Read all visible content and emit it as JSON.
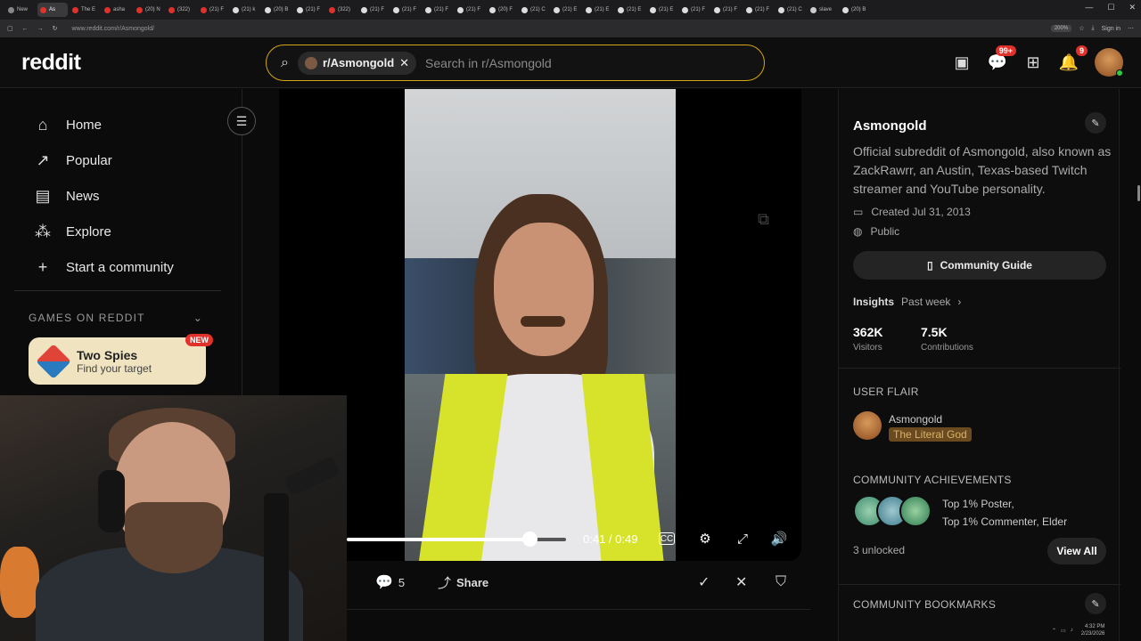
{
  "browser": {
    "tabs": [
      "New",
      "As",
      "The E",
      "asha",
      "(20) N",
      "(322)",
      "(21) F",
      "(21) k",
      "(20) B",
      "(21) F",
      "(322)",
      "(21) F",
      "(21) F",
      "(21) F",
      "(21) F",
      "(20) F",
      "(21) C",
      "(21) E",
      "(21) E",
      "(21) E",
      "(21) E",
      "(21) F",
      "(21) F",
      "(21) F",
      "(21) C",
      "slave",
      "(20) B"
    ],
    "active_tab": 1,
    "url": "www.reddit.com/r/Asmongold/",
    "zoom": "200%",
    "sign_in": "Sign in"
  },
  "header": {
    "logo": "reddit",
    "search_chip": "r/Asmongold",
    "search_placeholder": "Search in r/Asmongold",
    "chat_badge": "99+",
    "notif_badge": "9"
  },
  "sidebar": {
    "items": [
      {
        "label": "Home",
        "icon": "home-icon",
        "glyph": "⌂"
      },
      {
        "label": "Popular",
        "icon": "popular-icon",
        "glyph": "↗"
      },
      {
        "label": "News",
        "icon": "news-icon",
        "glyph": "▤"
      },
      {
        "label": "Explore",
        "icon": "explore-icon",
        "glyph": "⁂"
      },
      {
        "label": "Start a community",
        "icon": "plus-icon",
        "glyph": "+"
      }
    ],
    "games_header": "GAMES ON REDDIT",
    "game": {
      "title": "Two Spies",
      "subtitle": "Find your target",
      "badge": "NEW"
    }
  },
  "video": {
    "time": "0:41 / 0:49",
    "progress": 0.837,
    "cc_label": "CC"
  },
  "post_actions": {
    "comments": "5",
    "share": "Share"
  },
  "community": {
    "name": "Asmongold",
    "description": "Official subreddit of Asmongold, also known as ZackRawrr, an Austin, Texas-based Twitch streamer and YouTube personality.",
    "created": "Created Jul 31, 2013",
    "visibility": "Public",
    "guide": "Community Guide",
    "insights_label": "Insights",
    "insights_period": "Past week",
    "visitors": "362K",
    "visitors_label": "Visitors",
    "contributions": "7.5K",
    "contributions_label": "Contributions",
    "user_flair_header": "USER FLAIR",
    "flair_user": "Asmongold",
    "flair_tag": "The Literal God",
    "achievements_header": "COMMUNITY ACHIEVEMENTS",
    "achievement_line1": "Top 1% Poster,",
    "achievement_line2": "Top 1% Commenter, Elder",
    "unlocked": "3 unlocked",
    "view_all": "View All",
    "bookmarks_header": "COMMUNITY BOOKMARKS"
  },
  "taskbar": {
    "time": "4:32 PM",
    "date": "2/23/2026"
  },
  "colors": {
    "accent": "#d4a514",
    "badge_red": "#e0312b",
    "flair_tag_bg": "#6b4a20",
    "vest_yellow": "#d7e32a"
  }
}
